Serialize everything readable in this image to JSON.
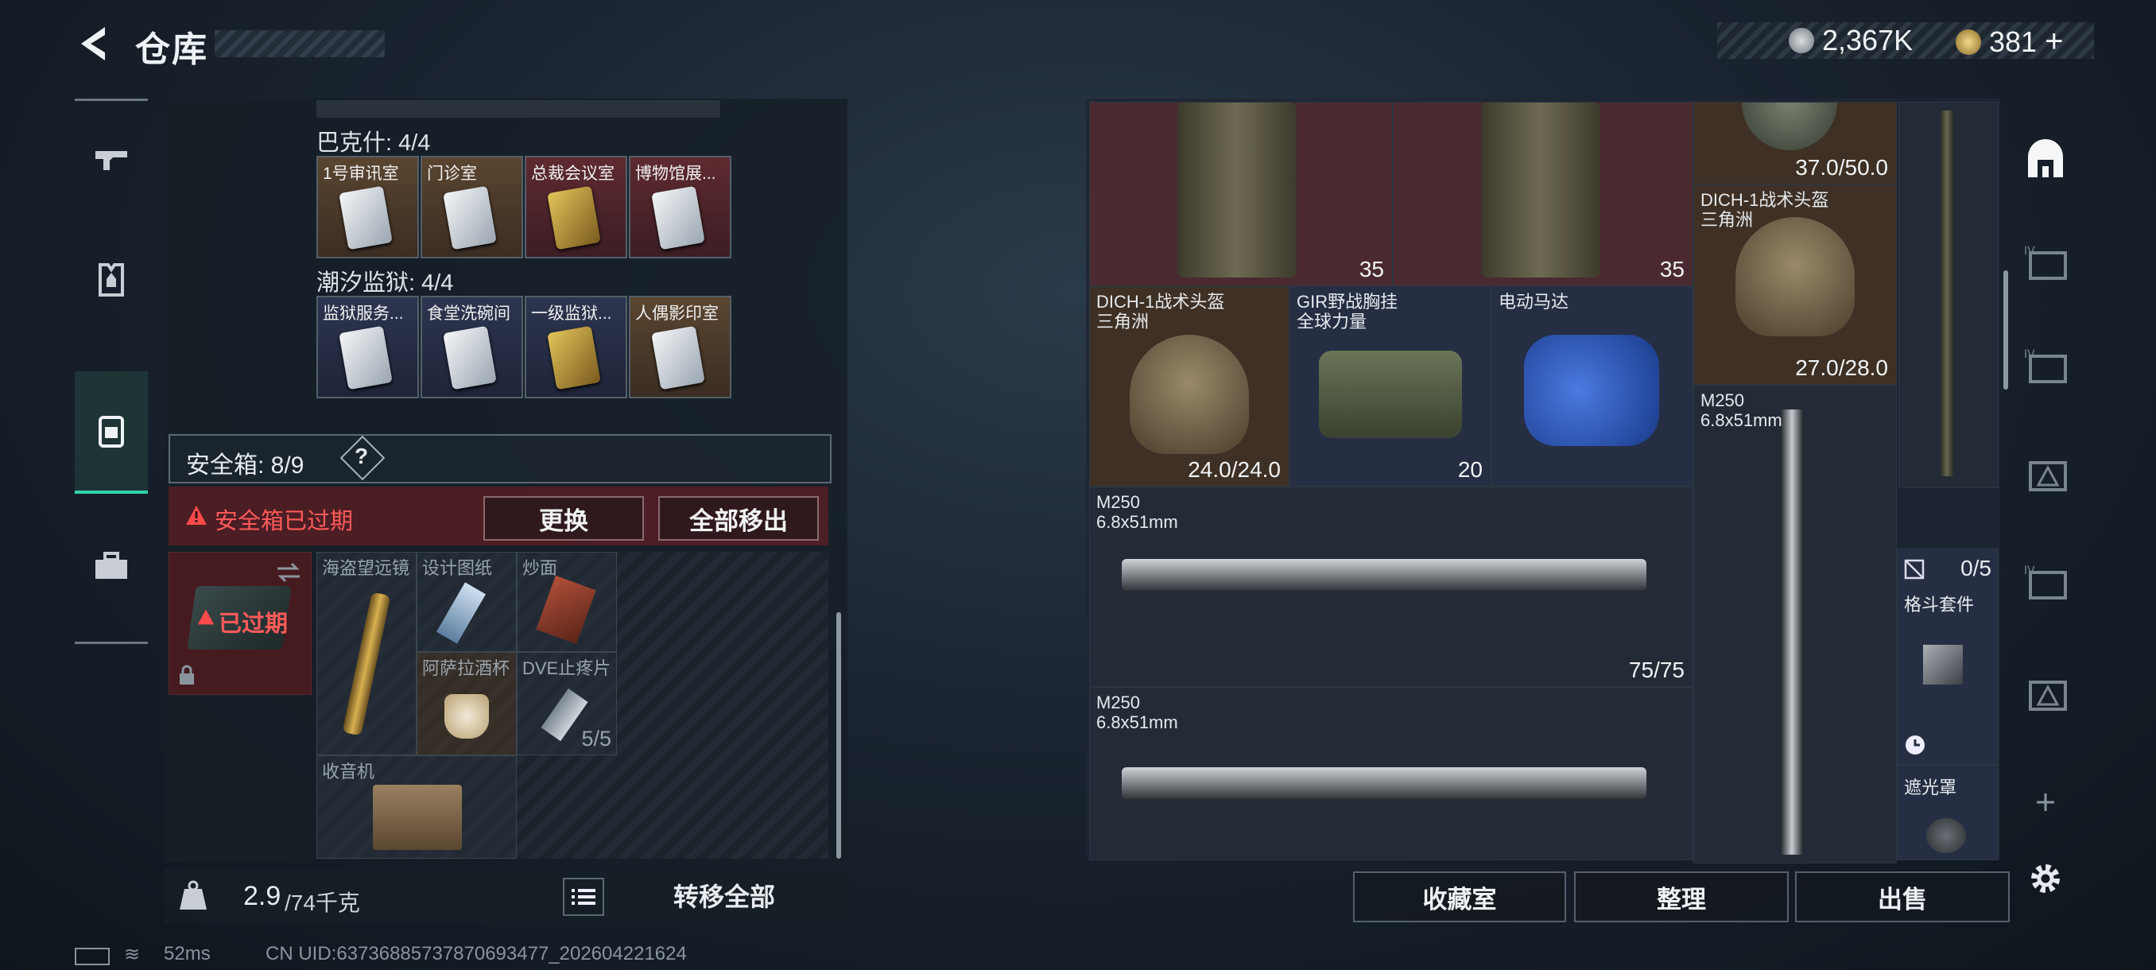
{
  "header": {
    "title": "仓库",
    "currency_silver": "2,367K",
    "currency_gold": "381",
    "currency_plus": "+"
  },
  "left": {
    "section1_label": "巴克什: 4/4",
    "section1_cards": [
      "1号审讯室",
      "门诊室",
      "总裁会议室",
      "博物馆展..."
    ],
    "section2_label": "潮汐监狱: 4/4",
    "section2_cards": [
      "监狱服务...",
      "食堂洗碗间",
      "一级监狱...",
      "人偶影印室"
    ],
    "safebox_label": "安全箱: 8/9",
    "help": "?",
    "expired_warning": "安全箱已过期",
    "replace_btn": "更换",
    "remove_all_btn": "全部移出",
    "expired_tag": "已过期",
    "items": {
      "telescope": "海盗望远镜",
      "blueprint": "设计图纸",
      "noodles": "炒面",
      "wine_cup": "阿萨拉酒杯",
      "dve": "DVE止疼片",
      "dve_count": "5/5",
      "radio": "收音机"
    },
    "weight": "2.9",
    "weight_max": "/74千克",
    "transfer_all": "转移全部"
  },
  "right": {
    "vest_count_1": "35",
    "vest_count_2": "35",
    "mask_dur": "37.0/50.0",
    "helmet_top_name": "DICH-1战术头盔",
    "helmet_top_sub": "三角洲",
    "helmet_top_dur": "27.0/28.0",
    "helmet_name": "DICH-1战术头盔",
    "helmet_sub": "三角洲",
    "helmet_dur": "24.0/24.0",
    "rig_name": "GIR野战胸挂",
    "rig_sub": "全球力量",
    "rig_count": "20",
    "motor_name": "电动马达",
    "m250_name": "M250",
    "m250_cal": "6.8x51mm",
    "m250_ammo": "75/75",
    "kit_count": "0/5",
    "kit_name": "格斗套件",
    "shade_name": "遮光罩"
  },
  "bottom": {
    "collection": "收藏室",
    "sort": "整理",
    "sell": "出售"
  },
  "status": {
    "ping": "52ms",
    "uid": "CN UID:637368857378706934​77_202604221624"
  },
  "colors": {
    "accent": "#2fd5a8",
    "danger": "#e0363c"
  }
}
